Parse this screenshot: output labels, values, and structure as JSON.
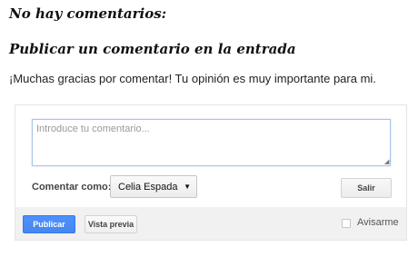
{
  "comments": {
    "none_label": "No hay comentarios:",
    "post_heading": "Publicar un comentario en la entrada",
    "thanks_message": "¡Muchas gracias por comentar! Tu opinión es muy importante para mi."
  },
  "form": {
    "textarea_placeholder": "Introduce tu comentario...",
    "textarea_value": "",
    "comment_as_label": "Comentar como:",
    "identity_selected": "Celia Espada (",
    "signout_label": "Salir",
    "publish_label": "Publicar",
    "preview_label": "Vista previa",
    "notify_label": "Avisarme",
    "notify_checked": false
  },
  "colors": {
    "accent": "#4d90fe",
    "footer_bg": "#f1f1f1",
    "textarea_border": "#a9c4e8"
  },
  "icons": {
    "select_caret": "caret-down-icon",
    "resize_grip": "resize-grip-icon"
  }
}
